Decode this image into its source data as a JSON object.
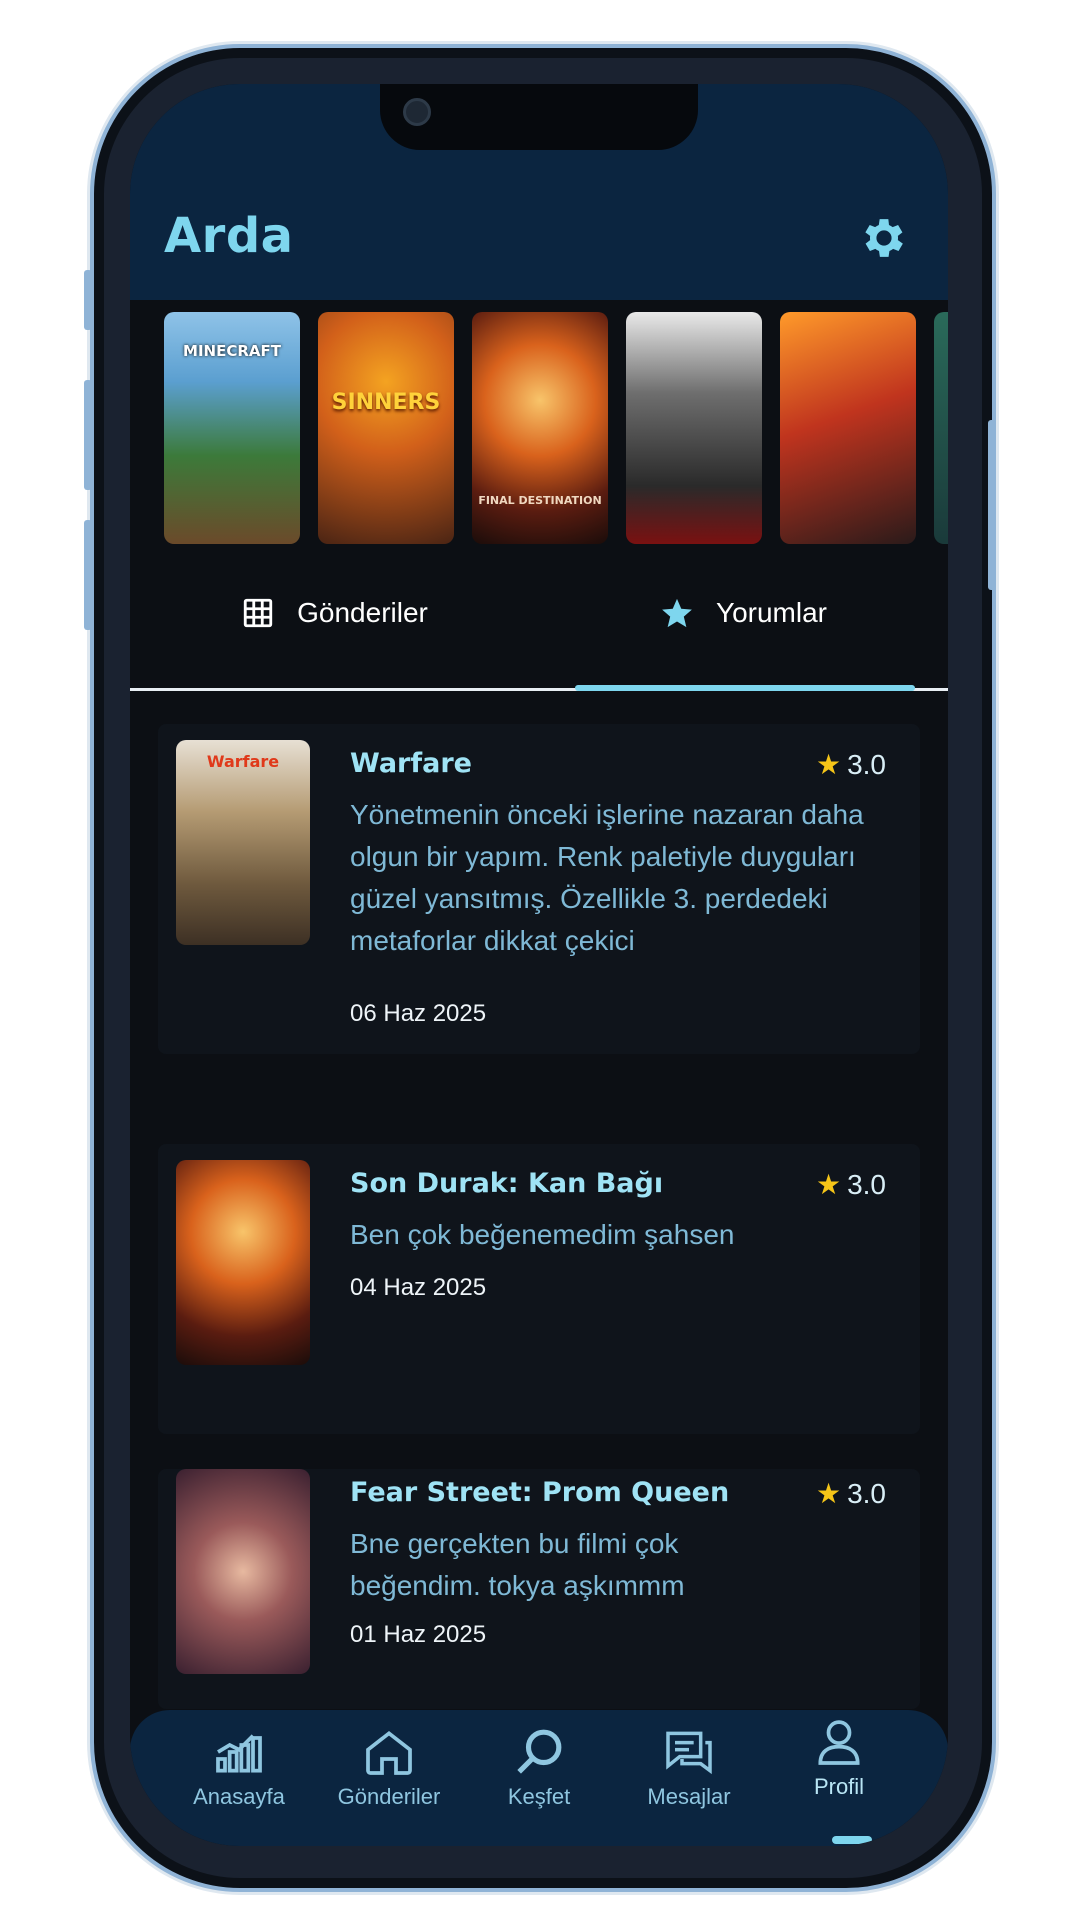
{
  "header": {
    "title": "Arda"
  },
  "posters": [
    {
      "name": "poster-minecraft",
      "text": "MINECRAFT"
    },
    {
      "name": "poster-sinners",
      "text": "SINNERS"
    },
    {
      "name": "poster-final-destination",
      "text": "FINAL DESTINATION"
    },
    {
      "name": "poster-mission-impossible",
      "text": ""
    },
    {
      "name": "poster-the-man",
      "text": ""
    }
  ],
  "tabs": [
    {
      "label": "Gönderiler",
      "icon": "grid-icon",
      "active": false
    },
    {
      "label": "Yorumlar",
      "icon": "star-icon",
      "active": true
    }
  ],
  "reviews": [
    {
      "title": "Warfare",
      "rating": "3.0",
      "text": "Yönetmenin önceki işlerine nazaran daha olgun bir yapım. Renk paletiyle duyguları güzel yansıtmış. Özellikle 3. perdedeki metaforlar dikkat çekici",
      "date": "06 Haz 2025"
    },
    {
      "title": "Son Durak: Kan Bağı",
      "rating": "3.0",
      "text": "Ben çok beğenemedim şahsen",
      "date": "04 Haz 2025"
    },
    {
      "title": "Fear Street: Prom Queen",
      "rating": "3.0",
      "text": "Bne gerçekten bu filmi çok beğendim. tokya aşkımmm",
      "date": "01 Haz 2025"
    }
  ],
  "nav": [
    {
      "label": "Anasayfa",
      "icon": "chart-icon"
    },
    {
      "label": "Gönderiler",
      "icon": "home-icon"
    },
    {
      "label": "Keşfet",
      "icon": "search-icon"
    },
    {
      "label": "Mesajlar",
      "icon": "messages-icon"
    },
    {
      "label": "Profil",
      "icon": "profile-icon",
      "active": true
    }
  ],
  "colors": {
    "accent": "#7ed6ee",
    "header_bg": "#0b2540",
    "star": "#f5c518"
  }
}
